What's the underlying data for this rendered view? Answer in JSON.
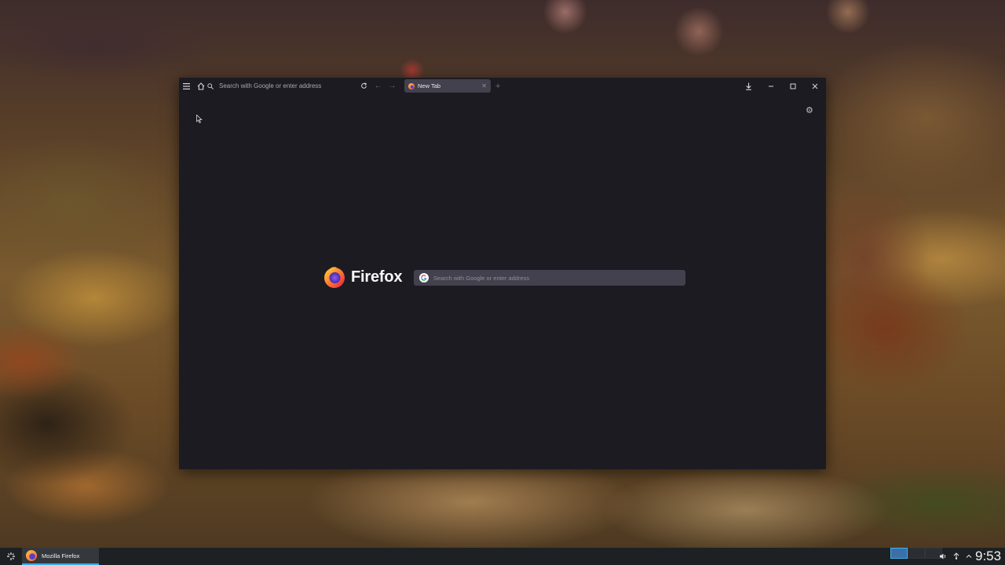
{
  "browser": {
    "urlbar": {
      "placeholder": "Search with Google or enter address"
    },
    "tabs": [
      {
        "title": "New Tab",
        "active": true
      }
    ],
    "brand_name": "Firefox",
    "newtab_search": {
      "placeholder": "Search with Google or enter address"
    }
  },
  "taskbar": {
    "task_items": [
      {
        "label": "Mozilla Firefox",
        "active": true
      }
    ],
    "desktops": 4,
    "active_desktop": 1,
    "clock": "9:53"
  },
  "colors": {
    "browser_bg": "#1c1b22",
    "tab_bg": "#42414d",
    "taskbar_bg": "#1e2124",
    "accent": "#3daee9"
  }
}
